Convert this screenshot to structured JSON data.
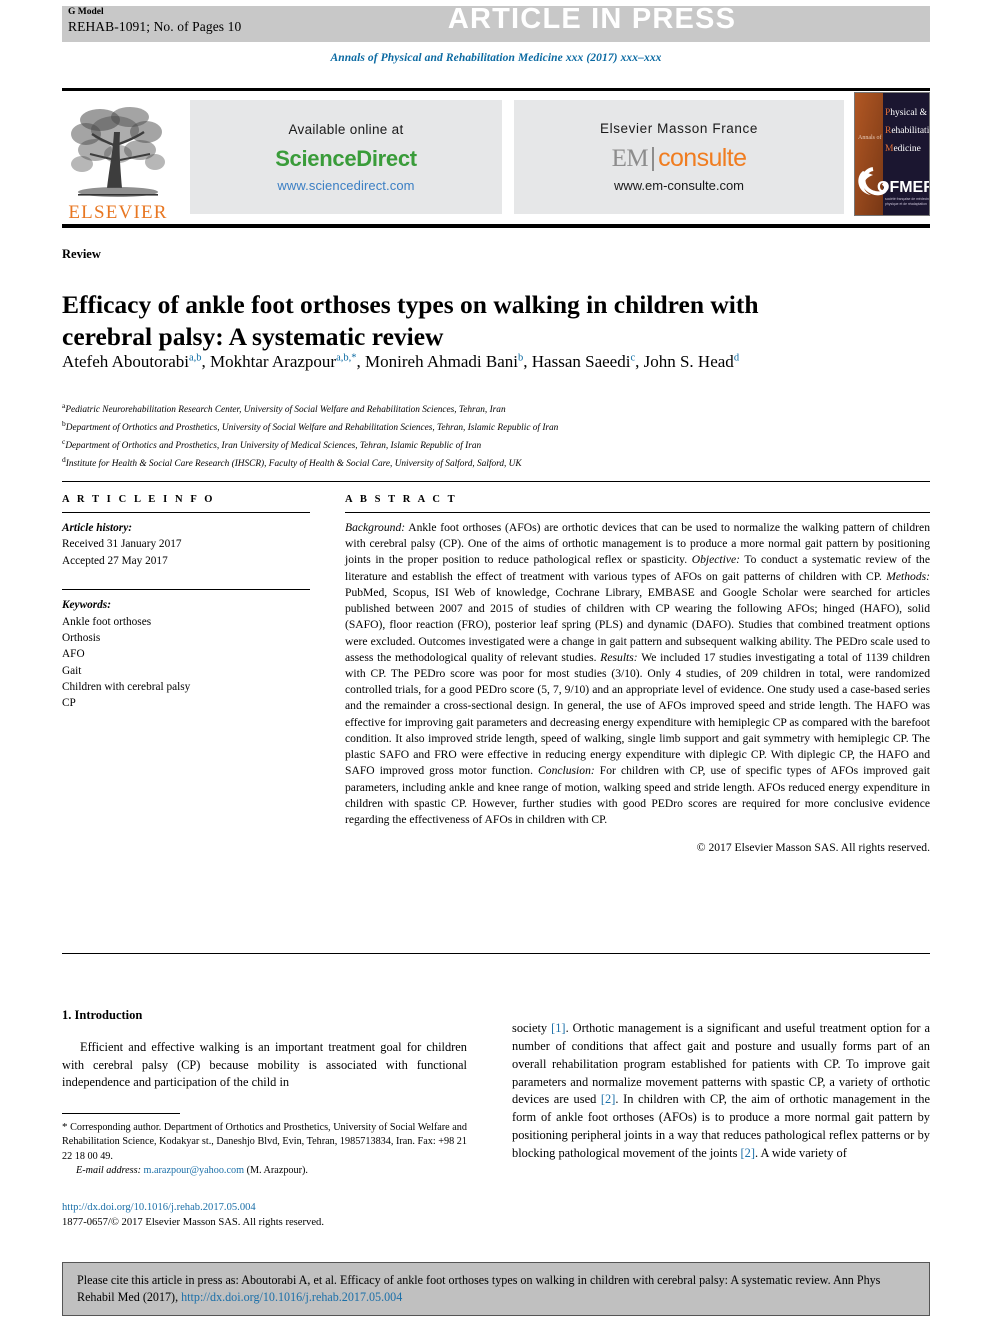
{
  "header": {
    "g_model": "G Model",
    "reference": "REHAB-1091; No. of Pages 10",
    "article_in_press": "ARTICLE IN PRESS",
    "journal_line": "Annals of Physical and Rehabilitation Medicine xxx (2017) xxx–xxx"
  },
  "masthead": {
    "elsevier_wordmark": "ELSEVIER",
    "sciencedirect": {
      "available_online": "Available online at",
      "logo": "ScienceDirect",
      "url": "www.sciencedirect.com"
    },
    "emconsulte": {
      "publisher": "Elsevier Masson France",
      "logo_left": "EM",
      "logo_right": "consulte",
      "url": "www.em-consulte.com"
    },
    "sofmer": {
      "annals_of": "Annals of",
      "line1": "Physical &",
      "line2": "Rehabilitation",
      "line3": "Medicine",
      "society": "SOFMER",
      "society_sub": "Société Française de Médecine Physique et de Réadaptation"
    }
  },
  "article": {
    "type_label": "Review",
    "title": "Efficacy of ankle foot orthoses types on walking in children with cerebral palsy: A systematic review",
    "authors_html": "Atefeh Aboutorabi<sup>a,b</sup>, Mokhtar Arazpour<sup>a,b,*</sup>, Monireh Ahmadi Bani<sup>b</sup>, Hassan Saeedi<sup>c</sup>, John S. Head<sup>d</sup>",
    "affiliations": [
      {
        "marker": "a",
        "text": "Pediatric Neurorehabilitation Research Center, University of Social Welfare and Rehabilitation Sciences, Tehran, Iran"
      },
      {
        "marker": "b",
        "text": "Department of Orthotics and Prosthetics, University of Social Welfare and Rehabilitation Sciences, Tehran, Islamic Republic of Iran"
      },
      {
        "marker": "c",
        "text": "Department of Orthotics and Prosthetics, Iran University of Medical Sciences, Tehran, Islamic Republic of Iran"
      },
      {
        "marker": "d",
        "text": "Institute for Health & Social Care Research (IHSCR), Faculty of Health & Social Care, University of Salford, Salford, UK"
      }
    ]
  },
  "article_info": {
    "heading": "A R T I C L E   I N F O",
    "history_label": "Article history:",
    "received": "Received 31 January 2017",
    "accepted": "Accepted 27 May 2017",
    "keywords_label": "Keywords:",
    "keywords": [
      "Ankle foot orthoses",
      "Orthosis",
      "AFO",
      "Gait",
      "Children with cerebral palsy",
      "CP"
    ]
  },
  "abstract": {
    "heading": "A B S T R A C T",
    "sections": [
      {
        "lead": "Background:",
        "text": " Ankle foot orthoses (AFOs) are orthotic devices that can be used to normalize the walking pattern of children with cerebral palsy (CP). One of the aims of orthotic management is to produce a more normal gait pattern by positioning joints in the proper position to reduce pathological reflex or spasticity."
      },
      {
        "lead": "Objective:",
        "text": " To conduct a systematic review of the literature and establish the effect of treatment with various types of AFOs on gait patterns of children with CP."
      },
      {
        "lead": "Methods:",
        "text": " PubMed, Scopus, ISI Web of knowledge, Cochrane Library, EMBASE and Google Scholar were searched for articles published between 2007 and 2015 of studies of children with CP wearing the following AFOs; hinged (HAFO), solid (SAFO), floor reaction (FRO), posterior leaf spring (PLS) and dynamic (DAFO). Studies that combined treatment options were excluded. Outcomes investigated were a change in gait pattern and subsequent walking ability. The PEDro scale used to assess the methodological quality of relevant studies."
      },
      {
        "lead": "Results:",
        "text": " We included 17 studies investigating a total of 1139 children with CP. The PEDro score was poor for most studies (3/10). Only 4 studies, of 209 children in total, were randomized controlled trials, for a good PEDro score (5, 7, 9/10) and an appropriate level of evidence. One study used a case-based series and the remainder a cross-sectional design. In general, the use of AFOs improved speed and stride length. The HAFO was effective for improving gait parameters and decreasing energy expenditure with hemiplegic CP as compared with the barefoot condition. It also improved stride length, speed of walking, single limb support and gait symmetry with hemiplegic CP. The plastic SAFO and FRO were effective in reducing energy expenditure with diplegic CP. With diplegic CP, the HAFO and SAFO improved gross motor function."
      },
      {
        "lead": "Conclusion:",
        "text": " For children with CP, use of specific types of AFOs improved gait parameters, including ankle and knee range of motion, walking speed and stride length. AFOs reduced energy expenditure in children with spastic CP. However, further studies with good PEDro scores are required for more conclusive evidence regarding the effectiveness of AFOs in children with CP."
      }
    ],
    "copyright": "© 2017 Elsevier Masson SAS. All rights reserved."
  },
  "body": {
    "section_heading": "1. Introduction",
    "left_paragraph": "Efficient and effective walking is an important treatment goal for children with cerebral palsy (CP) because mobility is associated with functional independence and participation of the child in",
    "right_paragraph_parts": [
      {
        "type": "text",
        "value": "society "
      },
      {
        "type": "cite",
        "value": "[1]"
      },
      {
        "type": "text",
        "value": ". Orthotic management is a significant and useful treatment option for a number of conditions that affect gait and posture and usually forms part of an overall rehabilitation program established for patients with CP. To improve gait parameters and normalize movement patterns with spastic CP, a variety of orthotic devices are used "
      },
      {
        "type": "cite",
        "value": "[2]"
      },
      {
        "type": "text",
        "value": ". In children with CP, the aim of orthotic management in the form of ankle foot orthoses (AFOs) is to produce a more normal gait pattern by positioning peripheral joints in a way that reduces pathological reflex patterns or by blocking pathological movement of the joints "
      },
      {
        "type": "cite",
        "value": "[2]"
      },
      {
        "type": "text",
        "value": ". A wide variety of"
      }
    ]
  },
  "footnote": {
    "star": "*",
    "corresponding": " Corresponding author. Department of Orthotics and Prosthetics, University of Social Welfare and Rehabilitation Science, Kodakyar st., Daneshjo Blvd, Evin, Tehran, 1985713834, Iran. Fax: +98 21 22 18 00 49.",
    "email_label": "E-mail address:",
    "email": "m.arazpour@yahoo.com",
    "email_suffix": " (M. Arazpour)."
  },
  "doi_block": {
    "doi": "http://dx.doi.org/10.1016/j.rehab.2017.05.004",
    "issn_line": "1877-0657/© 2017 Elsevier Masson SAS. All rights reserved."
  },
  "citation_footer": {
    "text_before": "Please cite this article in press as: Aboutorabi A, et al. Efficacy of ankle foot orthoses types on walking in children with cerebral palsy: A systematic review. Ann Phys Rehabil Med (2017), ",
    "link": "http://dx.doi.org/10.1016/j.rehab.2017.05.004"
  },
  "colors": {
    "journal_blue": "#0b6aa2",
    "elsevier_orange": "#E87722",
    "sciencedirect_green": "#3a9c3a",
    "link_blue": "#1b6fa8",
    "band_grey": "#c8c8c8",
    "panel_grey": "#e6e7e8",
    "footer_grey": "#c0c0c0"
  }
}
